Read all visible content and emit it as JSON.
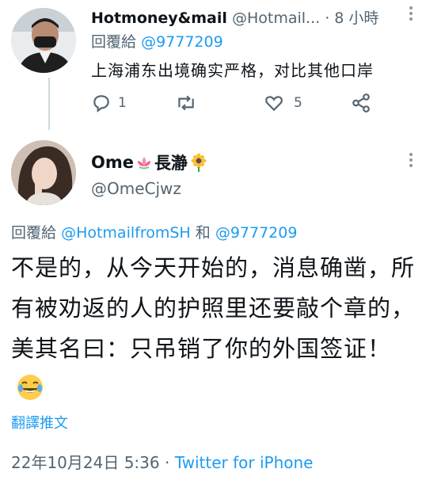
{
  "tweet1": {
    "name": "Hotmoney&mail",
    "handle": "@Hotmail...",
    "separator": "·",
    "time": "8 小時",
    "reply_prefix": "回覆給",
    "reply_handle": "@9777209",
    "text": "上海浦东出境确实严格，对比其他口岸",
    "replies": "1",
    "likes": "5"
  },
  "tweet2": {
    "name": "Ome",
    "name_suffix": "長瀞",
    "handle": "@OmeCjwz",
    "reply_prefix": "回覆給",
    "reply_handle1": "@HotmailfromSH",
    "reply_and": "和",
    "reply_handle2": "@9777209",
    "text": "不是的，从今天开始的，消息确凿，所有被劝返的人的护照里还要敲个章的，美其名曰：只吊销了你的外国签证！",
    "emoji": "😂",
    "translate": "翻譯推文",
    "date": "22年10月24日 5:36",
    "dot": "·",
    "source": "Twitter for iPhone"
  },
  "colors": {
    "link": "#1d9bf0",
    "muted": "#536471",
    "text": "#0f1419"
  },
  "icons": [
    "reply-icon",
    "retweet-icon",
    "like-icon",
    "share-icon",
    "more-icon",
    "lotus-emoji-icon",
    "sunflower-emoji-icon",
    "laughing-emoji-icon"
  ]
}
